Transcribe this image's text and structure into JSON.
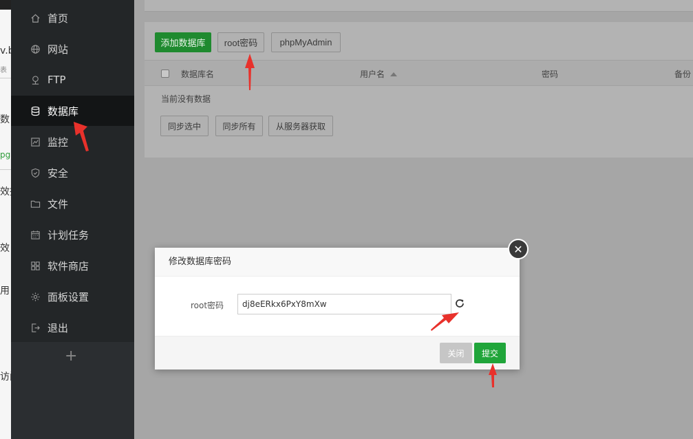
{
  "background_window": {
    "fragments": [
      "v.b",
      "表",
      "数",
      "pg",
      "效摄",
      "效",
      "用",
      "访问"
    ]
  },
  "sidebar": {
    "items": [
      {
        "label": "首页",
        "icon": "home-icon"
      },
      {
        "label": "网站",
        "icon": "globe-icon"
      },
      {
        "label": "FTP",
        "icon": "ftp-icon"
      },
      {
        "label": "数据库",
        "icon": "database-icon",
        "active": true
      },
      {
        "label": "监控",
        "icon": "monitor-icon"
      },
      {
        "label": "安全",
        "icon": "shield-icon"
      },
      {
        "label": "文件",
        "icon": "folder-icon"
      },
      {
        "label": "计划任务",
        "icon": "calendar-icon"
      },
      {
        "label": "软件商店",
        "icon": "grid-icon"
      },
      {
        "label": "面板设置",
        "icon": "gear-icon"
      },
      {
        "label": "退出",
        "icon": "logout-icon"
      }
    ],
    "add_label": "+"
  },
  "toolbar": {
    "add_db": "添加数据库",
    "root_password": "root密码",
    "phpmyadmin": "phpMyAdmin"
  },
  "table": {
    "columns": [
      "数据库名",
      "用户名",
      "密码",
      "备份"
    ],
    "empty_text": "当前没有数据"
  },
  "actions": {
    "sync_selected": "同步选中",
    "sync_all": "同步所有",
    "fetch_server": "从服务器获取"
  },
  "dialog": {
    "title": "修改数据库密码",
    "field_label": "root密码",
    "field_value": "dj8eERkx6PxY8mXw",
    "close_label": "关闭",
    "submit_label": "提交",
    "x_label": "✕"
  },
  "colors": {
    "accent_green": "#20a53a",
    "sidebar_bg": "#232628",
    "annotation_red": "#e8312b"
  }
}
